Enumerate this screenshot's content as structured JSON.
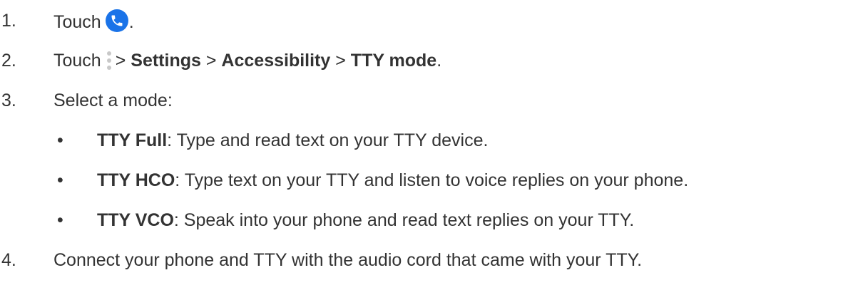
{
  "steps": [
    {
      "num": "1.",
      "text": "Touch",
      "icon": "phone-icon",
      "after": "."
    },
    {
      "num": "2.",
      "text": "Touch",
      "icon": "more-vertical-icon",
      "sep": ">",
      "settings": "Settings",
      "accessibility": "Accessibility",
      "tty_mode": "TTY mode",
      "after": "."
    },
    {
      "num": "3.",
      "text": "Select a mode:"
    },
    {
      "num": "4.",
      "text": "Connect your phone and TTY with the audio cord that came with your TTY."
    }
  ],
  "modes": [
    {
      "bullet": "•",
      "name": "TTY Full",
      "desc": ": Type and read text on your TTY device."
    },
    {
      "bullet": "•",
      "name": "TTY HCO",
      "desc": ": Type text on your TTY and listen to voice replies on your phone."
    },
    {
      "bullet": "•",
      "name": "TTY VCO",
      "desc": ": Speak into your phone and read text replies on your TTY."
    }
  ],
  "colors": {
    "text": "#333333",
    "phone_icon_bg": "#1a73e8",
    "menu_dots": "#c8c8c8"
  }
}
